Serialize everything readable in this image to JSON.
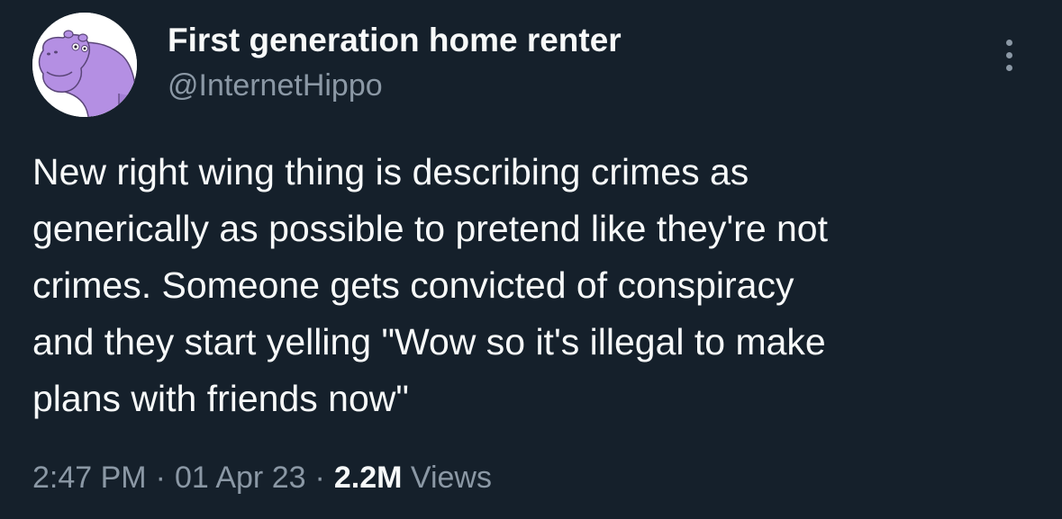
{
  "author": {
    "display_name": "First generation home renter",
    "handle": "@InternetHippo",
    "avatar_icon": "hippo-avatar-icon"
  },
  "menu": {
    "icon": "more-options-icon"
  },
  "tweet": {
    "lines": [
      "New right wing thing is describing crimes as",
      "generically as possible to pretend like they're not",
      "crimes. Someone gets convicted of conspiracy",
      "and they start yelling \"Wow so it's illegal to make",
      "plans with friends now\""
    ]
  },
  "meta": {
    "time": "2:47 PM",
    "separator": "·",
    "date": "01 Apr 23",
    "views_count": "2.2M",
    "views_label": "Views"
  },
  "colors": {
    "background": "#15202b",
    "primary_text": "#f7f9f9",
    "secondary_text": "#8b98a5",
    "avatar_purple": "#b48fe3"
  }
}
